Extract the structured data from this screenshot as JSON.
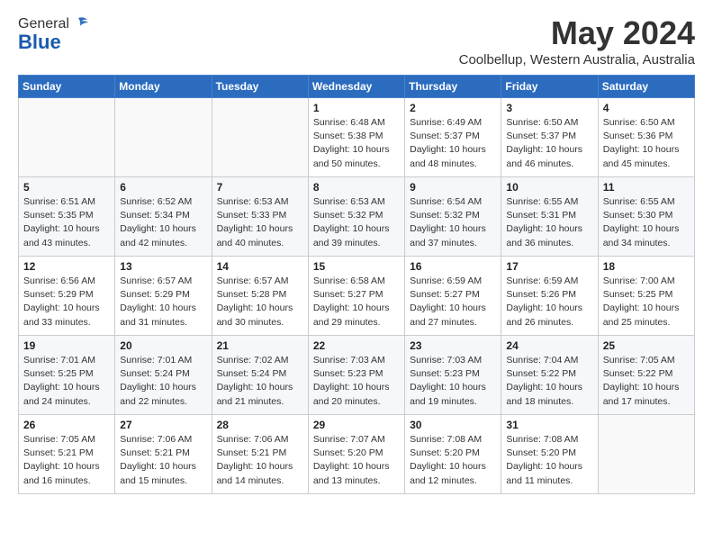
{
  "header": {
    "logo_general": "General",
    "logo_blue": "Blue",
    "main_title": "May 2024",
    "sub_title": "Coolbellup, Western Australia, Australia"
  },
  "weekdays": [
    "Sunday",
    "Monday",
    "Tuesday",
    "Wednesday",
    "Thursday",
    "Friday",
    "Saturday"
  ],
  "weeks": [
    [
      {
        "day": "",
        "sunrise": "",
        "sunset": "",
        "daylight": ""
      },
      {
        "day": "",
        "sunrise": "",
        "sunset": "",
        "daylight": ""
      },
      {
        "day": "",
        "sunrise": "",
        "sunset": "",
        "daylight": ""
      },
      {
        "day": "1",
        "sunrise": "Sunrise: 6:48 AM",
        "sunset": "Sunset: 5:38 PM",
        "daylight": "Daylight: 10 hours and 50 minutes."
      },
      {
        "day": "2",
        "sunrise": "Sunrise: 6:49 AM",
        "sunset": "Sunset: 5:37 PM",
        "daylight": "Daylight: 10 hours and 48 minutes."
      },
      {
        "day": "3",
        "sunrise": "Sunrise: 6:50 AM",
        "sunset": "Sunset: 5:37 PM",
        "daylight": "Daylight: 10 hours and 46 minutes."
      },
      {
        "day": "4",
        "sunrise": "Sunrise: 6:50 AM",
        "sunset": "Sunset: 5:36 PM",
        "daylight": "Daylight: 10 hours and 45 minutes."
      }
    ],
    [
      {
        "day": "5",
        "sunrise": "Sunrise: 6:51 AM",
        "sunset": "Sunset: 5:35 PM",
        "daylight": "Daylight: 10 hours and 43 minutes."
      },
      {
        "day": "6",
        "sunrise": "Sunrise: 6:52 AM",
        "sunset": "Sunset: 5:34 PM",
        "daylight": "Daylight: 10 hours and 42 minutes."
      },
      {
        "day": "7",
        "sunrise": "Sunrise: 6:53 AM",
        "sunset": "Sunset: 5:33 PM",
        "daylight": "Daylight: 10 hours and 40 minutes."
      },
      {
        "day": "8",
        "sunrise": "Sunrise: 6:53 AM",
        "sunset": "Sunset: 5:32 PM",
        "daylight": "Daylight: 10 hours and 39 minutes."
      },
      {
        "day": "9",
        "sunrise": "Sunrise: 6:54 AM",
        "sunset": "Sunset: 5:32 PM",
        "daylight": "Daylight: 10 hours and 37 minutes."
      },
      {
        "day": "10",
        "sunrise": "Sunrise: 6:55 AM",
        "sunset": "Sunset: 5:31 PM",
        "daylight": "Daylight: 10 hours and 36 minutes."
      },
      {
        "day": "11",
        "sunrise": "Sunrise: 6:55 AM",
        "sunset": "Sunset: 5:30 PM",
        "daylight": "Daylight: 10 hours and 34 minutes."
      }
    ],
    [
      {
        "day": "12",
        "sunrise": "Sunrise: 6:56 AM",
        "sunset": "Sunset: 5:29 PM",
        "daylight": "Daylight: 10 hours and 33 minutes."
      },
      {
        "day": "13",
        "sunrise": "Sunrise: 6:57 AM",
        "sunset": "Sunset: 5:29 PM",
        "daylight": "Daylight: 10 hours and 31 minutes."
      },
      {
        "day": "14",
        "sunrise": "Sunrise: 6:57 AM",
        "sunset": "Sunset: 5:28 PM",
        "daylight": "Daylight: 10 hours and 30 minutes."
      },
      {
        "day": "15",
        "sunrise": "Sunrise: 6:58 AM",
        "sunset": "Sunset: 5:27 PM",
        "daylight": "Daylight: 10 hours and 29 minutes."
      },
      {
        "day": "16",
        "sunrise": "Sunrise: 6:59 AM",
        "sunset": "Sunset: 5:27 PM",
        "daylight": "Daylight: 10 hours and 27 minutes."
      },
      {
        "day": "17",
        "sunrise": "Sunrise: 6:59 AM",
        "sunset": "Sunset: 5:26 PM",
        "daylight": "Daylight: 10 hours and 26 minutes."
      },
      {
        "day": "18",
        "sunrise": "Sunrise: 7:00 AM",
        "sunset": "Sunset: 5:25 PM",
        "daylight": "Daylight: 10 hours and 25 minutes."
      }
    ],
    [
      {
        "day": "19",
        "sunrise": "Sunrise: 7:01 AM",
        "sunset": "Sunset: 5:25 PM",
        "daylight": "Daylight: 10 hours and 24 minutes."
      },
      {
        "day": "20",
        "sunrise": "Sunrise: 7:01 AM",
        "sunset": "Sunset: 5:24 PM",
        "daylight": "Daylight: 10 hours and 22 minutes."
      },
      {
        "day": "21",
        "sunrise": "Sunrise: 7:02 AM",
        "sunset": "Sunset: 5:24 PM",
        "daylight": "Daylight: 10 hours and 21 minutes."
      },
      {
        "day": "22",
        "sunrise": "Sunrise: 7:03 AM",
        "sunset": "Sunset: 5:23 PM",
        "daylight": "Daylight: 10 hours and 20 minutes."
      },
      {
        "day": "23",
        "sunrise": "Sunrise: 7:03 AM",
        "sunset": "Sunset: 5:23 PM",
        "daylight": "Daylight: 10 hours and 19 minutes."
      },
      {
        "day": "24",
        "sunrise": "Sunrise: 7:04 AM",
        "sunset": "Sunset: 5:22 PM",
        "daylight": "Daylight: 10 hours and 18 minutes."
      },
      {
        "day": "25",
        "sunrise": "Sunrise: 7:05 AM",
        "sunset": "Sunset: 5:22 PM",
        "daylight": "Daylight: 10 hours and 17 minutes."
      }
    ],
    [
      {
        "day": "26",
        "sunrise": "Sunrise: 7:05 AM",
        "sunset": "Sunset: 5:21 PM",
        "daylight": "Daylight: 10 hours and 16 minutes."
      },
      {
        "day": "27",
        "sunrise": "Sunrise: 7:06 AM",
        "sunset": "Sunset: 5:21 PM",
        "daylight": "Daylight: 10 hours and 15 minutes."
      },
      {
        "day": "28",
        "sunrise": "Sunrise: 7:06 AM",
        "sunset": "Sunset: 5:21 PM",
        "daylight": "Daylight: 10 hours and 14 minutes."
      },
      {
        "day": "29",
        "sunrise": "Sunrise: 7:07 AM",
        "sunset": "Sunset: 5:20 PM",
        "daylight": "Daylight: 10 hours and 13 minutes."
      },
      {
        "day": "30",
        "sunrise": "Sunrise: 7:08 AM",
        "sunset": "Sunset: 5:20 PM",
        "daylight": "Daylight: 10 hours and 12 minutes."
      },
      {
        "day": "31",
        "sunrise": "Sunrise: 7:08 AM",
        "sunset": "Sunset: 5:20 PM",
        "daylight": "Daylight: 10 hours and 11 minutes."
      },
      {
        "day": "",
        "sunrise": "",
        "sunset": "",
        "daylight": ""
      }
    ]
  ]
}
